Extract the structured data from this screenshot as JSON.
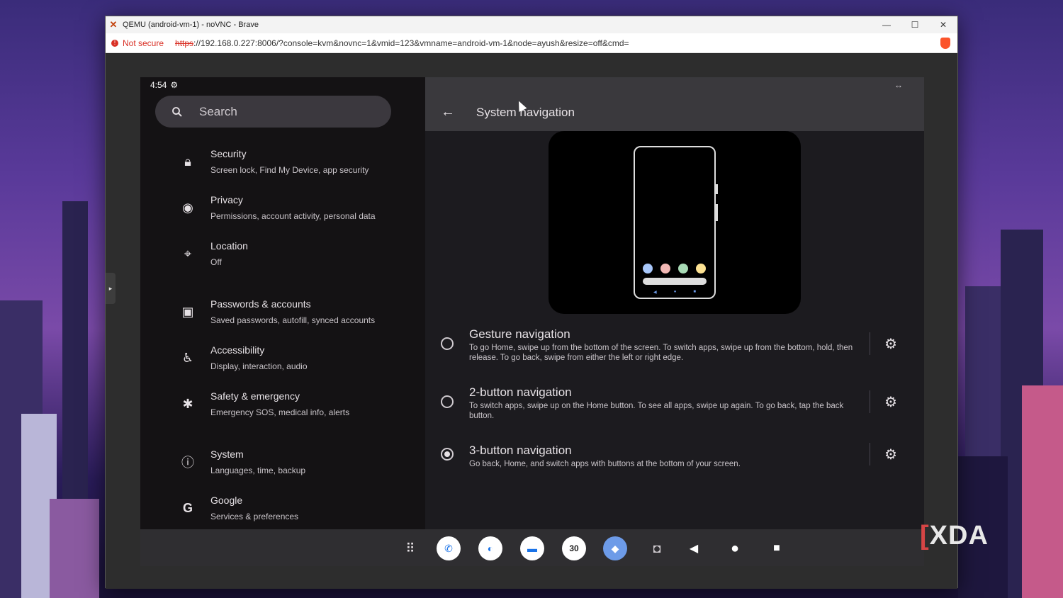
{
  "browser": {
    "title": "QEMU (android-vm-1) - noVNC - Brave",
    "not_secure": "Not secure",
    "url_scheme": "https",
    "url_rest": "://192.168.0.227:8006/?console=kvm&novnc=1&vmid=123&vmname=android-vm-1&node=ayush&resize=off&cmd="
  },
  "status": {
    "time": "4:54"
  },
  "search": {
    "placeholder": "Search"
  },
  "sidebar": {
    "items": [
      {
        "title": "Security",
        "subtitle": "Screen lock, Find My Device, app security",
        "icon": "lock-icon"
      },
      {
        "title": "Privacy",
        "subtitle": "Permissions, account activity, personal data",
        "icon": "privacy-eye-icon"
      },
      {
        "title": "Location",
        "subtitle": "Off",
        "icon": "location-pin-icon"
      },
      {
        "title": "Passwords & accounts",
        "subtitle": "Saved passwords, autofill, synced accounts",
        "icon": "account-box-icon"
      },
      {
        "title": "Accessibility",
        "subtitle": "Display, interaction, audio",
        "icon": "accessibility-icon"
      },
      {
        "title": "Safety & emergency",
        "subtitle": "Emergency SOS, medical info, alerts",
        "icon": "emergency-asterisk-icon"
      },
      {
        "title": "System",
        "subtitle": "Languages, time, backup",
        "icon": "info-icon"
      },
      {
        "title": "Google",
        "subtitle": "Services & preferences",
        "icon": "google-g-icon"
      }
    ]
  },
  "panel": {
    "title": "System navigation",
    "options": [
      {
        "title": "Gesture navigation",
        "desc": "To go Home, swipe up from the bottom of the screen. To switch apps, swipe up from the bottom, hold, then release. To go back, swipe from either the left or right edge.",
        "selected": false
      },
      {
        "title": "2-button navigation",
        "desc": "To switch apps, swipe up on the Home button. To see all apps, swipe up again. To go back, tap the back button.",
        "selected": false
      },
      {
        "title": "3-button navigation",
        "desc": "Go back, Home, and switch apps with buttons at the bottom of your screen.",
        "selected": true
      }
    ]
  },
  "taskbar": {
    "calendar_day": "30",
    "apps": [
      "app-drawer-icon",
      "phone-icon",
      "duo-icon",
      "messages-icon",
      "calendar-icon",
      "maps-icon",
      "camera-icon"
    ]
  },
  "watermark": {
    "text": "XDA"
  },
  "colors": {
    "dot1": "#a8c7fa",
    "dot2": "#f2b8b5",
    "dot3": "#a8dab5",
    "dot4": "#fde293"
  }
}
